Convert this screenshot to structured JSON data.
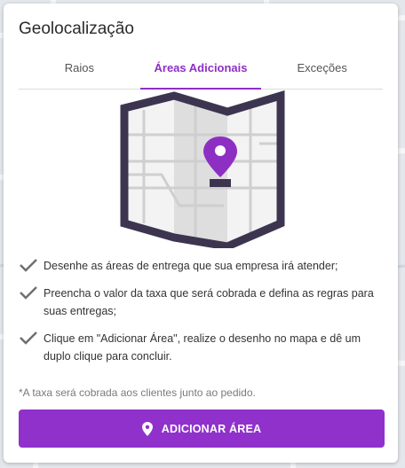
{
  "dialog": {
    "title": "Geolocalização"
  },
  "tabs": [
    {
      "label": "Raios",
      "active": false
    },
    {
      "label": "Áreas Adicionais",
      "active": true
    },
    {
      "label": "Exceções",
      "active": false
    }
  ],
  "instructions": [
    "Desenhe as áreas de entrega que sua empresa irá atender;",
    "Preencha o valor da taxa que será cobrada e defina as regras para suas entregas;",
    "Clique em \"Adicionar Área\", realize o desenho no mapa e dê um duplo clique para concluir."
  ],
  "note": "*A taxa será cobrada aos clientes junto ao pedido.",
  "action": {
    "label": "ADICIONAR ÁREA",
    "icon": "location-pin-icon"
  },
  "colors": {
    "accent": "#9031cc",
    "map_frame": "#3d3550",
    "pin": "#8e2fc4"
  }
}
